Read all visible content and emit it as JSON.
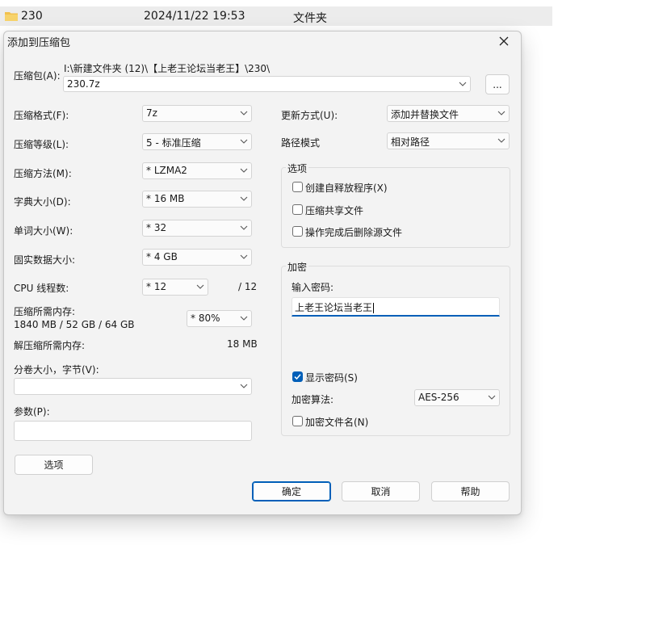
{
  "background": {
    "file_name": "230",
    "file_date": "2024/11/22 19:53",
    "file_type": "文件夹"
  },
  "dialog": {
    "title": "添加到压缩包",
    "archive_label": "压缩包(A):",
    "archive_path": "I:\\新建文件夹 (12)\\【上老王论坛当老王】\\230\\",
    "archive_name": "230.7z",
    "browse_label": "...",
    "format_label": "压缩格式(F):",
    "format_value": "7z",
    "level_label": "压缩等级(L):",
    "level_value": "5 - 标准压缩",
    "method_label": "压缩方法(M):",
    "method_value": "*  LZMA2",
    "dict_label": "字典大小(D):",
    "dict_value": "*  16 MB",
    "word_label": "单词大小(W):",
    "word_value": "*  32",
    "solid_label": "固实数据大小:",
    "solid_value": "*  4 GB",
    "threads_label": "CPU 线程数:",
    "threads_value": "*  12",
    "threads_total": "/ 12",
    "mem_label": "压缩所需内存:",
    "mem_value": "1840 MB / 52 GB / 64 GB",
    "mem_percent": "*  80%",
    "decomp_label": "解压缩所需内存:",
    "decomp_value": "18 MB",
    "split_label": "分卷大小，字节(V):",
    "split_value": "",
    "params_label": "参数(P):",
    "params_value": "",
    "options_button": "选项",
    "update_label": "更新方式(U):",
    "update_value": "添加并替换文件",
    "pathmode_label": "路径模式",
    "pathmode_value": "相对路径",
    "options_group_title": "选项",
    "opt_sfx": "创建自释放程序(X)",
    "opt_shared": "压缩共享文件",
    "opt_delete": "操作完成后删除源文件",
    "encrypt_group_title": "加密",
    "password_label": "输入密码:",
    "password_value": "上老王论坛当老王",
    "show_password_label": "显示密码(S)",
    "show_password_checked": true,
    "enc_method_label": "加密算法:",
    "enc_method_value": "AES-256",
    "encrypt_names_label": "加密文件名(N)",
    "ok_button": "确定",
    "cancel_button": "取消",
    "help_button": "帮助"
  },
  "colors": {
    "accent": "#005fb8",
    "dialog_bg": "#f3f3f3",
    "folder": "#f2c14e"
  }
}
